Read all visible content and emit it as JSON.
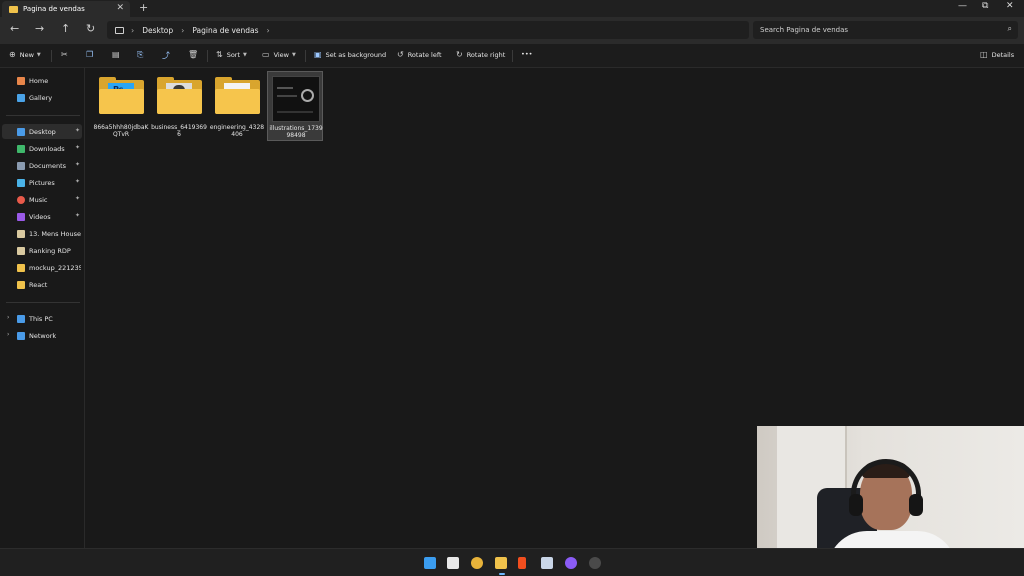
{
  "window": {
    "tab_title": "Pagina de vendas",
    "tab_close": "✕",
    "new_tab": "+",
    "controls": {
      "minimize": "—",
      "maximize": "⧉",
      "close": "✕"
    }
  },
  "nav": {
    "back": "←",
    "forward": "→",
    "up": "↑",
    "refresh": "↻"
  },
  "breadcrumb": {
    "items": [
      "Desktop",
      "Pagina de vendas"
    ],
    "separator": "›"
  },
  "search": {
    "placeholder": "Search Pagina de vendas"
  },
  "toolbar": {
    "new_label": "New",
    "sort_label": "Sort",
    "view_label": "View",
    "set_background_label": "Set as background",
    "rotate_left_label": "Rotate left",
    "rotate_right_label": "Rotate right",
    "more_label": "•••",
    "details_label": "Details"
  },
  "sidebar": {
    "items": [
      {
        "label": "Home",
        "color": "#e8864a"
      },
      {
        "label": "Gallery",
        "color": "#4aa3e8"
      },
      {
        "label": "Desktop",
        "color": "#4a9be8",
        "pinned": true,
        "selected": true
      },
      {
        "label": "Downloads",
        "color": "#3fb86b",
        "pinned": true
      },
      {
        "label": "Documents",
        "color": "#8a9bb0",
        "pinned": true
      },
      {
        "label": "Pictures",
        "color": "#4ab3e8",
        "pinned": true
      },
      {
        "label": "Music",
        "color": "#e85a4a",
        "pinned": true
      },
      {
        "label": "Videos",
        "color": "#9a5ae8",
        "pinned": true
      },
      {
        "label": "13. Mens House",
        "color": "#d9c9a0"
      },
      {
        "label": "Ranking RDP",
        "color": "#d9c9a0"
      },
      {
        "label": "mockup_221235242",
        "color": "#f0c24b"
      },
      {
        "label": "React",
        "color": "#f0c24b"
      },
      {
        "label": "This PC",
        "color": "#4a9be8"
      },
      {
        "label": "Network",
        "color": "#4a9be8"
      }
    ],
    "pin_glyph": "📌",
    "expander": "›"
  },
  "files": [
    {
      "name": "866a5hhh80jdbaKQTvR",
      "kind": "folder",
      "preview": "ps"
    },
    {
      "name": "business_64193696",
      "kind": "folder",
      "preview": "photo"
    },
    {
      "name": "engineering_4328406",
      "kind": "folder",
      "preview": "paper"
    },
    {
      "name": "illustrations_173998498",
      "kind": "image",
      "selected": true
    }
  ],
  "taskbar": {
    "apps": [
      "windows-start",
      "notion",
      "chrome",
      "file-explorer",
      "figma",
      "photoshop",
      "browser-purple",
      "steam"
    ]
  }
}
